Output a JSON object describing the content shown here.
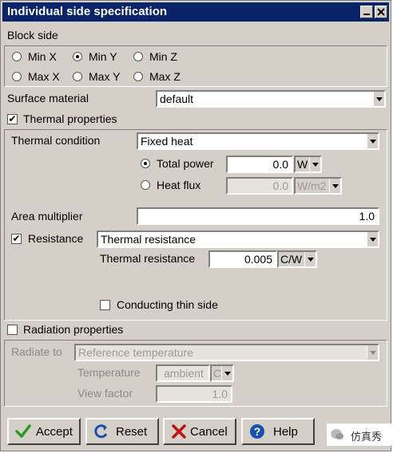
{
  "window": {
    "title": "Individual side specification"
  },
  "block_side": {
    "label": "Block side",
    "options": [
      "Min X",
      "Min Y",
      "Min Z",
      "Max X",
      "Max Y",
      "Max Z"
    ],
    "selected": "Min Y"
  },
  "surface_material": {
    "label": "Surface material",
    "value": "default"
  },
  "thermal_properties": {
    "label": "Thermal properties",
    "checked": true,
    "condition_label": "Thermal condition",
    "condition_value": "Fixed heat",
    "total_power": {
      "label": "Total power",
      "value": "0.0",
      "unit": "W"
    },
    "heat_flux": {
      "label": "Heat flux",
      "value": "0.0",
      "unit": "W/m2"
    },
    "area_multiplier": {
      "label": "Area multiplier",
      "value": "1.0"
    },
    "resistance": {
      "label": "Resistance",
      "checked": true,
      "type_value": "Thermal resistance",
      "value_label": "Thermal resistance",
      "value": "0.005",
      "unit": "C/W"
    },
    "conducting_thin_side": {
      "label": "Conducting thin side",
      "checked": false
    }
  },
  "radiation_properties": {
    "label": "Radiation properties",
    "checked": false,
    "radiate_to_label": "Radiate to",
    "radiate_to_value": "Reference temperature",
    "temperature_label": "Temperature",
    "temperature_value": "ambient",
    "temperature_unit": "C",
    "view_factor_label": "View factor",
    "view_factor_value": "1.0"
  },
  "buttons": {
    "accept": "Accept",
    "reset": "Reset",
    "cancel": "Cancel",
    "help": "Help"
  },
  "watermark": {
    "text": "仿真秀"
  },
  "colors": {
    "titlebar": "#0a246a",
    "face": "#d4d0c8",
    "accept_check": "#2a9a2a",
    "cancel_x": "#c01010",
    "help_blue": "#1a4fb0"
  }
}
